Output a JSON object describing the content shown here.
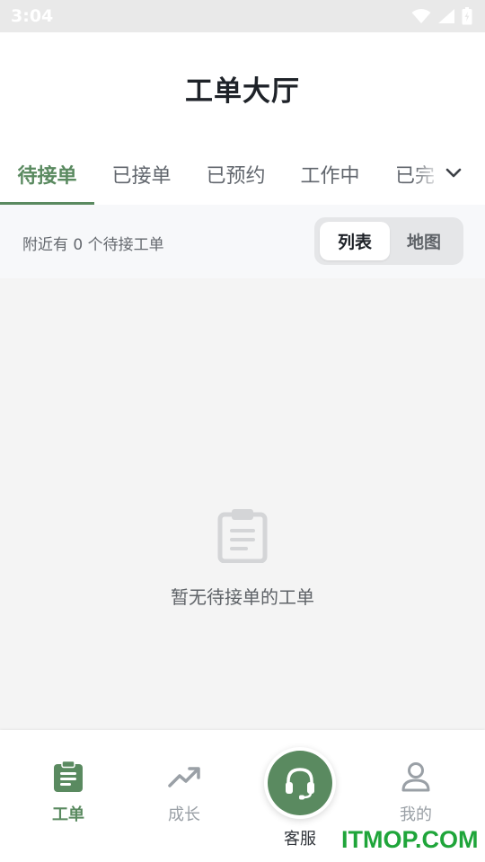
{
  "status_bar": {
    "time": "3:04"
  },
  "header": {
    "title": "工单大厅"
  },
  "tabs": [
    {
      "label": "待接单",
      "active": true
    },
    {
      "label": "已接单",
      "active": false
    },
    {
      "label": "已预约",
      "active": false
    },
    {
      "label": "工作中",
      "active": false
    },
    {
      "label": "已完",
      "active": false
    }
  ],
  "filter": {
    "nearby_text": "附近有 0 个待接工单",
    "view_list": "列表",
    "view_map": "地图",
    "selected_view": "列表"
  },
  "empty_state": {
    "message": "暂无待接单的工单",
    "icon": "clipboard-icon"
  },
  "bottom_nav": {
    "items": [
      {
        "label": "工单",
        "icon": "clipboard-icon",
        "active": true
      },
      {
        "label": "成长",
        "icon": "trending-up-icon",
        "active": false
      },
      {
        "label": "客服",
        "icon": "headset-icon",
        "active": false
      },
      {
        "label": "我的",
        "icon": "user-icon",
        "active": false
      }
    ]
  },
  "watermark": "ITMOP.COM",
  "colors": {
    "accent": "#5a8a60",
    "title": "#1e2228",
    "muted": "#9aa0a6",
    "background": "#f4f4f4"
  }
}
